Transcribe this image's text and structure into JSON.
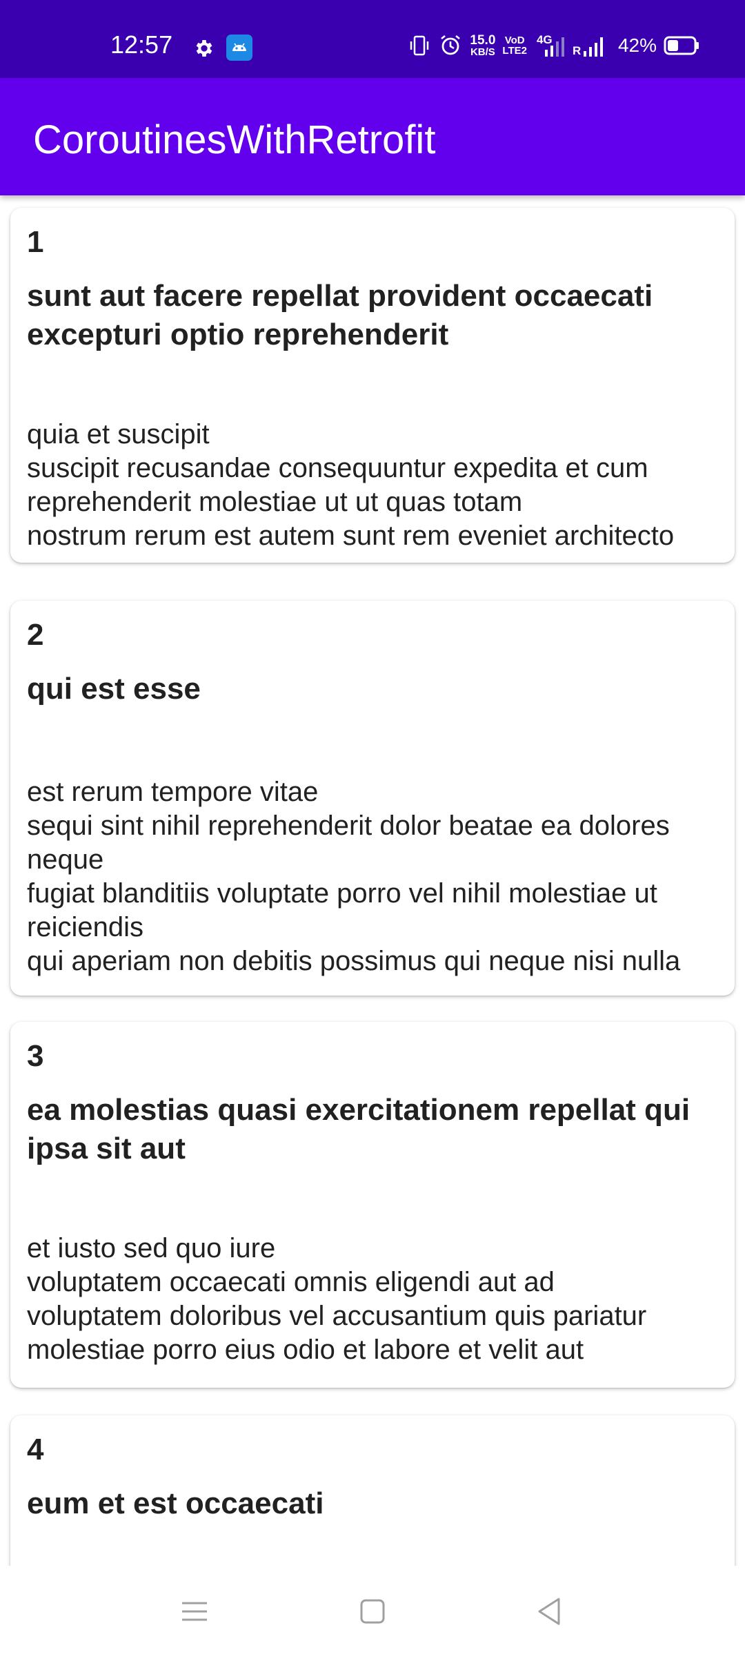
{
  "status_bar": {
    "time": "12:57",
    "network_speed_value": "15.0",
    "network_speed_unit": "KB/S",
    "volte_top": "VoD",
    "volte_bottom": "LTE2",
    "network_type": "4G",
    "roaming": "R",
    "battery_percent": "42%",
    "battery_level": 0.42,
    "icons": [
      "gear-icon",
      "android-debug-icon",
      "vibrate-icon",
      "alarm-icon",
      "signal-icon",
      "battery-icon"
    ]
  },
  "app_bar": {
    "title": "CoroutinesWithRetrofit",
    "color": "#6200ee",
    "status_color": "#3a00b0"
  },
  "posts": [
    {
      "id": "1",
      "title": "sunt aut facere repellat provident occaecati excepturi optio reprehenderit",
      "body": "quia et suscipit\nsuscipit recusandae consequuntur expedita et cum reprehenderit molestiae ut ut quas totam\nnostrum rerum est autem sunt rem eveniet architecto"
    },
    {
      "id": "2",
      "title": "qui est esse",
      "body": "est rerum tempore vitae\nsequi sint nihil reprehenderit dolor beatae ea dolores neque\nfugiat blanditiis voluptate porro vel nihil molestiae ut reiciendis\nqui aperiam non debitis possimus qui neque nisi nulla"
    },
    {
      "id": "3",
      "title": "ea molestias quasi exercitationem repellat qui ipsa sit aut",
      "body": "et iusto sed quo iure\nvoluptatem occaecati omnis eligendi aut ad\nvoluptatem doloribus vel accusantium quis pariatur\nmolestiae porro eius odio et labore et velit aut"
    },
    {
      "id": "4",
      "title": "eum et est occaecati",
      "body": ""
    }
  ],
  "nav_bar": {
    "icons": [
      "menu-icon",
      "home-square-icon",
      "back-triangle-icon"
    ]
  }
}
